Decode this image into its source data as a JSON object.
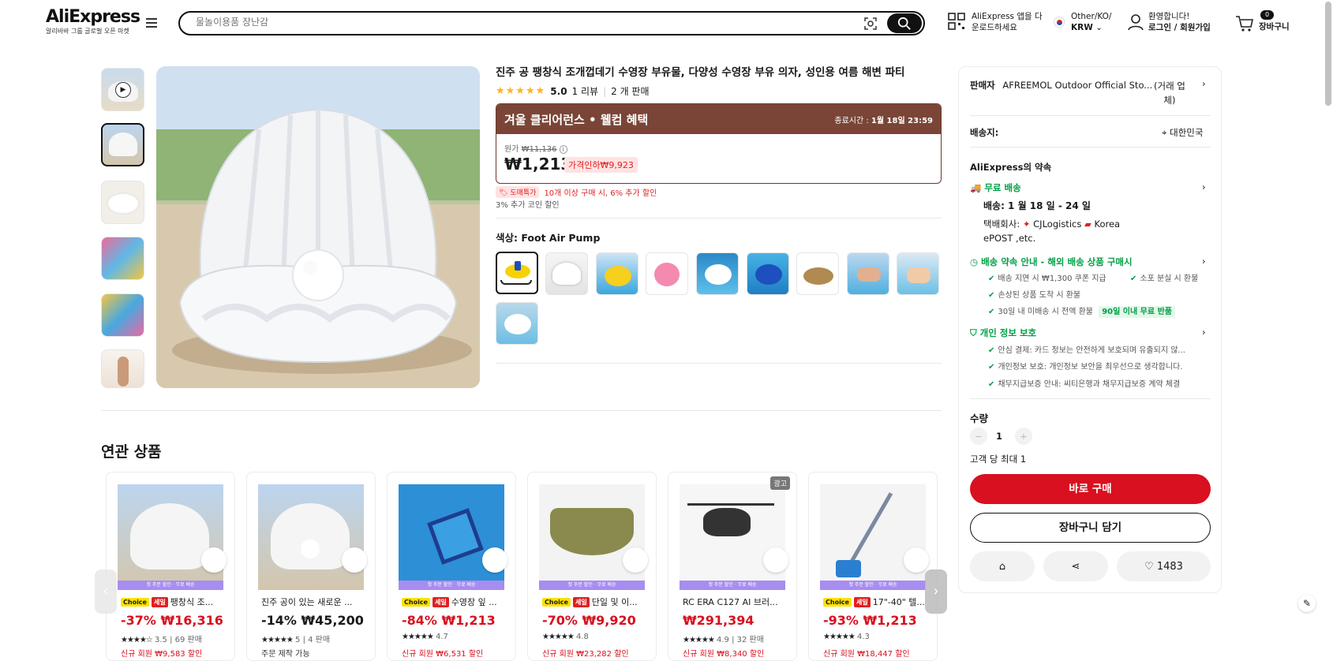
{
  "header": {
    "logo": "AliExpress",
    "logo_sub": "알리바바 그룹 글로벌 오픈 마켓",
    "search_placeholder": "물놀이용품 장난감",
    "app_line1": "AliExpress 앱을 다",
    "app_line2": "운로드하세요",
    "locale_line1": "Other/KO/",
    "locale_line2": "KRW",
    "account_line1": "환영합니다!",
    "account_line2": "로그인 / 회원가입",
    "cart_count": "0",
    "cart_label": "장바구니"
  },
  "product": {
    "title": "진주 공 팽창식 조개껍데기 수영장 부유물, 다양성 수영장 부유 의자, 성인용 여름 해변 파티",
    "rating": "5.0",
    "reviews": "1 리뷰",
    "sold": "2 개 판매",
    "promo_title": "겨울 클리어런스 • 웰컴 혜택",
    "promo_end_label": "종료시간 :",
    "promo_end": "1월 18일 23:59",
    "orig_label": "원가",
    "orig_price": "₩11,136",
    "price": "₩1,213",
    "discount": "가격인하₩9,923",
    "bulk_tag": "도매특가",
    "bulk_text": "10개 이상 구매 시, 6% 추가 할인",
    "coin_text": "3% 추가 코인 할인",
    "color_label": "색상:",
    "color_value": "Foot Air Pump"
  },
  "side": {
    "seller_label": "판매자",
    "seller_name": "AFREEMOL Outdoor Official Sto...",
    "seller_type1": "(거래 업",
    "seller_type2": "체)",
    "ship_to_label": "배송지:",
    "ship_to": "대한민국",
    "promise_title": "AliExpress의 약속",
    "free_ship": "무료 배송",
    "delivery": "배송: 1 월 18 일 - 24 일",
    "carrier_label": "택배회사:",
    "carrier1": "CJLogistics",
    "carrier2": "Korea",
    "carrier3": "ePOST ,etc.",
    "guarantee_title": "배송 약속 안내 - 해외 배송 상품 구매시",
    "g1": "배송 지연 시 ₩1,300 쿠폰 지급",
    "g2": "소포 분실 시 환불",
    "g3": "손상된 상품 도착 시 환불",
    "g4": "30일 내 미배송 시 전액 환불",
    "g4_badge": "90일 이내 무료 반품",
    "privacy_title": "개인 정보 보호",
    "p1": "안심 결제: 카드 정보는 안전하게 보호되며 유출되지 않...",
    "p2": "개인정보 보호: 개인정보 보안을 최우선으로 생각합니다.",
    "p3": "채무지급보증 안내: 씨티은행과 채무지급보증 계약 체결",
    "qty_label": "수량",
    "qty": "1",
    "qty_limit": "고객 당 최대 1",
    "buy_now": "바로 구매",
    "add_cart": "장바구니 담기",
    "wish_count": "1483"
  },
  "related": {
    "title": "연관 상품",
    "strip_text": "첫 주문 할인 · 무료 배송",
    "ad_label": "광고",
    "choice": "Choice",
    "sale": "세일",
    "items": [
      {
        "name": "팽창식 조...",
        "price": "-37% ₩16,316",
        "stars": "★★★★☆",
        "rating": "3.5",
        "sold": "69 판매",
        "promo": "신규 회원 ₩9,583 할인"
      },
      {
        "name": "진주 공이 있는 새로운 ...",
        "price": "-14% ₩45,200",
        "stars": "★★★★★",
        "rating": "5",
        "sold": "4 판매",
        "promo": "주문 제작 가능"
      },
      {
        "name": "수영장 잎 ...",
        "price": "-84% ₩1,213",
        "stars": "★★★★★",
        "rating": "4.7",
        "sold": "",
        "promo": "신규 회원 ₩6,531 할인"
      },
      {
        "name": "단일 및 이...",
        "price": "-70% ₩9,920",
        "stars": "★★★★★",
        "rating": "4.8",
        "sold": "",
        "promo": "신규 회원 ₩23,282 할인"
      },
      {
        "name": "RC ERA C127 AI 브러...",
        "price": "₩291,394",
        "stars": "★★★★★",
        "rating": "4.9",
        "sold": "32 판매",
        "promo": "신규 회원 ₩8,340 할인"
      },
      {
        "name": "17\"-40\" 텔...",
        "price": "-93% ₩1,213",
        "stars": "★★★★★",
        "rating": "4.3",
        "sold": "",
        "promo": "신규 회원 ₩18,447 할인"
      }
    ]
  }
}
